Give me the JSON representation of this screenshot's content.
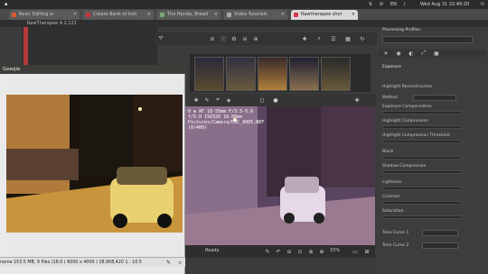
{
  "topbar": {
    "indicators": [
      "⌐",
      "⇅",
      "✉",
      "EN",
      "♪"
    ],
    "datetime": "Wed Aug 31 22:49:20"
  },
  "browser_tabs": [
    {
      "label": "Basic Editing in",
      "color": "#e25a2c"
    },
    {
      "label": "Create Bank of Indi",
      "color": "#c33"
    },
    {
      "label": "The Honda, Bread",
      "color": "#7a7"
    },
    {
      "label": "Video Tutorials",
      "color": "#aaa"
    },
    {
      "label": "Rawtherapee shor",
      "color": "#d35",
      "active": true
    }
  ],
  "rawtherapee": {
    "title": "RawTherapee 4.2.121",
    "exif": {
      "line1": "0 ▪ AF 18-55mm F/3.5-5.6",
      "line2": "f/5.0  ISO320  18.00mm",
      "line3": "Pictures/Camera/DSC_0005.NEF",
      "line4": "(0/400)"
    },
    "processing_profiles_label": "Processing Profiles",
    "panel_sections": [
      {
        "label": "Exposure"
      },
      {
        "label": "Highlight Reconstruction"
      },
      {
        "label": "Method"
      },
      {
        "label": "Exposure Compensation"
      },
      {
        "label": "Highlight Compression"
      },
      {
        "label": "Highlight Compression Threshold"
      },
      {
        "label": "Black"
      },
      {
        "label": "Shadow Compression"
      },
      {
        "label": "Lightness"
      },
      {
        "label": "Contrast"
      },
      {
        "label": "Saturation"
      }
    ],
    "tone_curves": [
      "Tone Curve 1",
      "Tone Curve 2"
    ],
    "ready_label": "Ready",
    "zoom": "33%"
  },
  "geeqie": {
    "title": "Geeqie",
    "status": "name  153.5 MB, 9 files (16.0 ( 6000 x 4000 ) 18,908,420  1 : 10.5"
  }
}
